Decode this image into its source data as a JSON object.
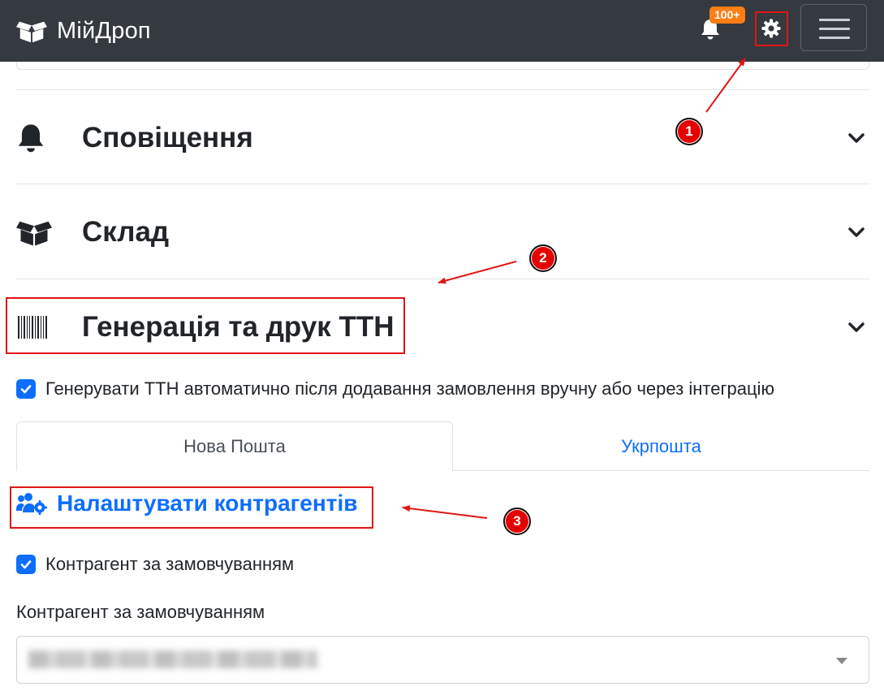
{
  "navbar": {
    "brand": "МійДроп",
    "notifications_badge": "100+",
    "icons": [
      "box-open-icon",
      "bell-icon",
      "gear-icon",
      "hamburger-icon"
    ]
  },
  "sections": [
    {
      "title": "Сповіщення",
      "icon": "bell-icon"
    },
    {
      "title": "Склад",
      "icon": "box-open-icon"
    },
    {
      "title": "Генерація та друк ТТН",
      "icon": "barcode-icon"
    }
  ],
  "auto_generate": {
    "checked": true,
    "label": "Генерувати ТТН автоматично після додавання замовлення вручну або через інтеграцію"
  },
  "tabs": [
    {
      "label": "Нова Пошта",
      "active": true
    },
    {
      "label": "Укрпошта",
      "active": false
    }
  ],
  "configure_link": {
    "label": "Налаштувати контрагентів",
    "icon": "users-cog-icon"
  },
  "default_contractor": {
    "checked": true,
    "label": "Контрагент за замовчуванням"
  },
  "contractor_field": {
    "label": "Контрагент за замовчуванням",
    "value_blurred": true
  },
  "annotations": {
    "markers": [
      "1",
      "2",
      "3"
    ],
    "color": "#e50000"
  },
  "colors": {
    "navbar": "#343a40",
    "primary": "#0d6efd",
    "badge": "#fd7e14"
  }
}
